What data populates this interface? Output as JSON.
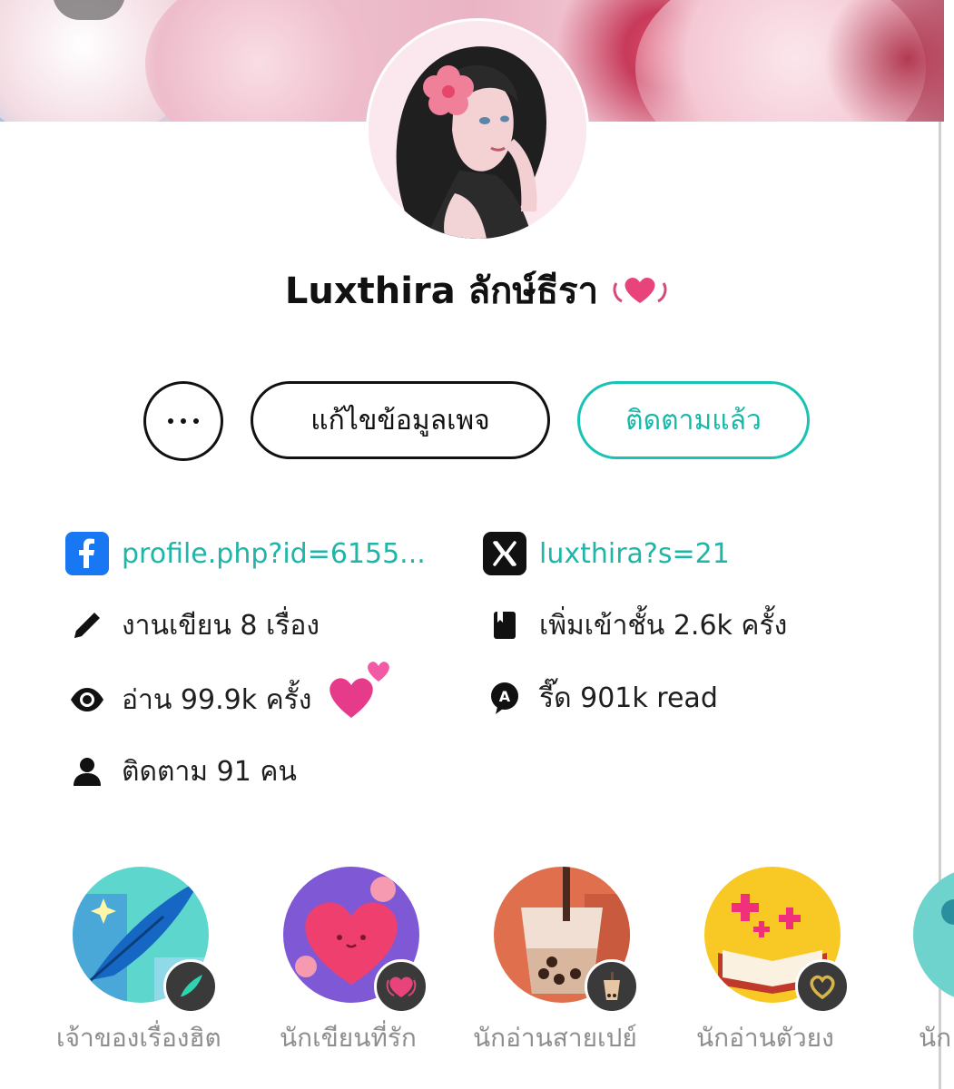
{
  "profile": {
    "name": "Luxthira ลักษ์ธีรา"
  },
  "actions": {
    "more_label": "...",
    "edit_label": "แก้ไขข้อมูลเพจ",
    "follow_label": "ติดตามแล้ว"
  },
  "links": {
    "facebook": "profile.php?id=6155...",
    "x": "luxthira?s=21"
  },
  "stats": {
    "works": "งานเขียน 8 เรื่อง",
    "shelf": "เพิ่มเข้าชั้น 2.6k ครั้ง",
    "reads": "อ่าน 99.9k ครั้ง",
    "read_alt": "รี๊ด 901k read",
    "followers": "ติดตาม 91 คน"
  },
  "badges": [
    {
      "label": "เจ้าของเรื่องฮิต",
      "icon": "feather-icon"
    },
    {
      "label": "นักเขียนที่รัก",
      "icon": "heart-icon"
    },
    {
      "label": "นักอ่านสายเปย์",
      "icon": "bubble-tea-icon"
    },
    {
      "label": "นักอ่านตัวยง",
      "icon": "open-book-icon"
    },
    {
      "label": "นัก",
      "icon": "chat-icon"
    }
  ],
  "colors": {
    "accent": "#18c3b4",
    "facebook": "#1877f2",
    "heart": "#e8437a"
  }
}
